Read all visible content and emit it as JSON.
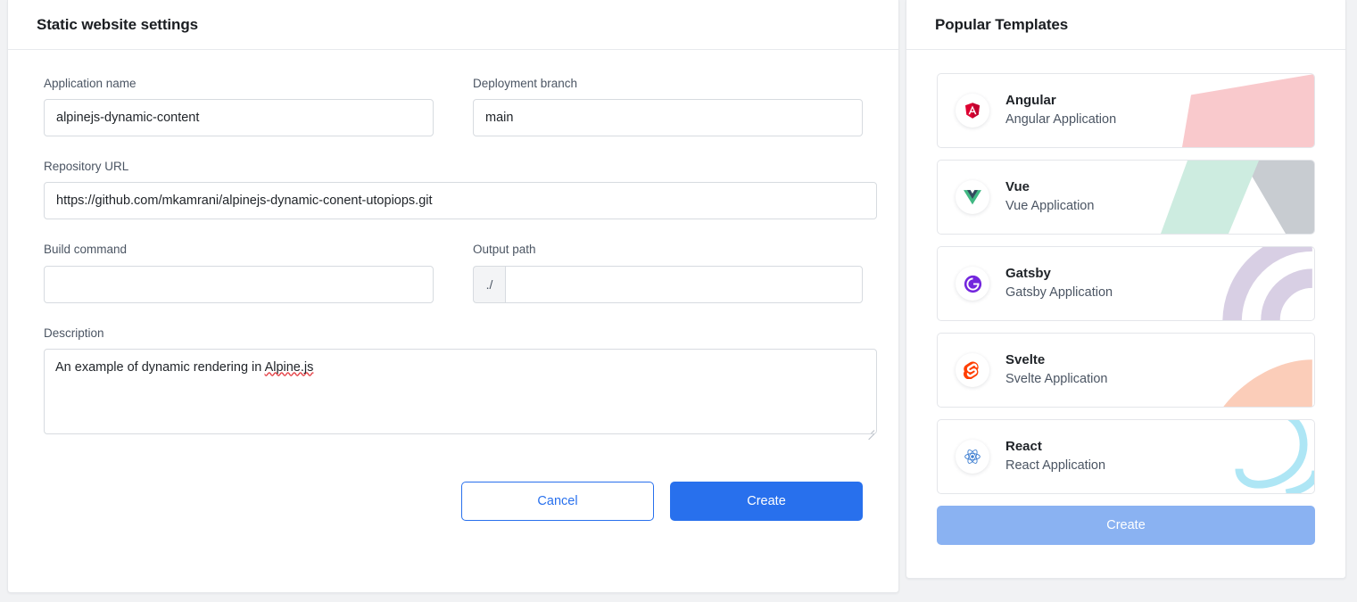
{
  "left_panel": {
    "title": "Static website settings",
    "fields": {
      "application_name": {
        "label": "Application name",
        "value": "alpinejs-dynamic-content",
        "placeholder": ""
      },
      "deployment_branch": {
        "label": "Deployment branch",
        "value": "main",
        "placeholder": ""
      },
      "repository_url": {
        "label": "Repository URL",
        "value": "https://github.com/mkamrani/alpinejs-dynamic-conent-utopiops.git",
        "placeholder": ""
      },
      "build_command": {
        "label": "Build command",
        "value": "",
        "placeholder": ""
      },
      "output_path": {
        "label": "Output path",
        "prefix": "./",
        "value": "",
        "placeholder": ""
      },
      "description": {
        "label": "Description",
        "value": "An example of dynamic rendering in Alpine.js",
        "misspelled_word": "Alpine.js",
        "prefix_text": "An example of dynamic rendering in ",
        "placeholder": ""
      }
    },
    "buttons": {
      "cancel": "Cancel",
      "create": "Create"
    }
  },
  "right_panel": {
    "title": "Popular Templates",
    "templates": [
      {
        "name": "Angular",
        "description": "Angular Application",
        "icon": "angular-icon",
        "accent": "#dd0031",
        "deco": "#f9c9cc"
      },
      {
        "name": "Vue",
        "description": "Vue Application",
        "icon": "vue-icon",
        "accent": "#41b883",
        "deco": "#cdece0"
      },
      {
        "name": "Gatsby",
        "description": "Gatsby Application",
        "icon": "gatsby-icon",
        "accent": "#7326dd",
        "deco": "#d8cfe4"
      },
      {
        "name": "Svelte",
        "description": "Svelte Application",
        "icon": "svelte-icon",
        "accent": "#ff3e00",
        "deco": "#fbcdb9"
      },
      {
        "name": "React",
        "description": "React Application",
        "icon": "react-icon",
        "accent": "#3f7fd1",
        "deco": "#aee6f5"
      }
    ],
    "create_button": "Create"
  },
  "colors": {
    "primary": "#2870ed",
    "primary_disabled": "#8ab2f2",
    "background": "#f1f2f4",
    "border": "#d7dbe0",
    "text": "#1f2328",
    "label": "#4b5563"
  }
}
